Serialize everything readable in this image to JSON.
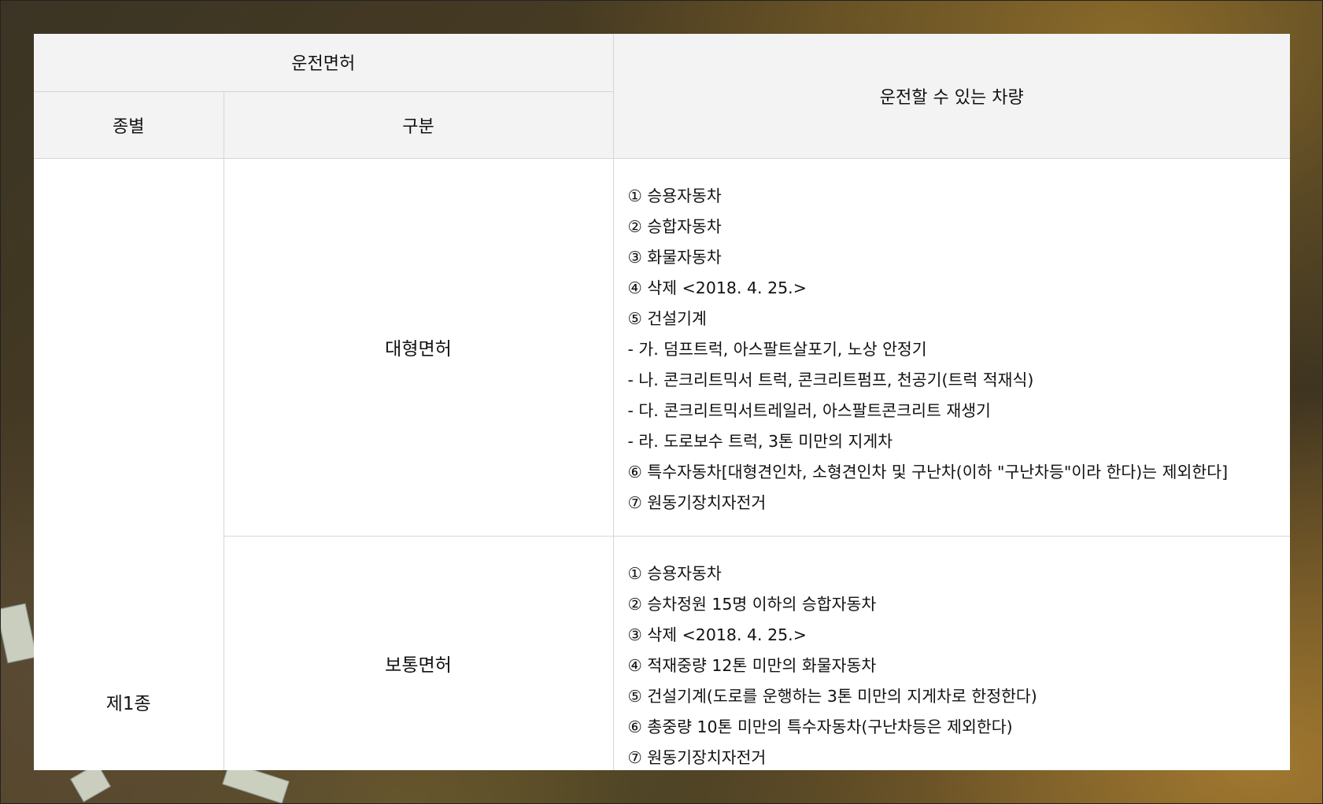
{
  "table": {
    "header": {
      "license_group": "운전면허",
      "vehicles": "운전할 수 있는 차량",
      "type": "종별",
      "category": "구분"
    },
    "type_cell": "제1종",
    "rows": [
      {
        "category": "대형면허",
        "items": [
          "① 승용자동차",
          "② 승합자동차",
          "③ 화물자동차",
          "④ 삭제 <2018. 4. 25.>",
          "⑤ 건설기계",
          "- 가. 덤프트럭, 아스팔트살포기, 노상 안정기",
          "- 나. 콘크리트믹서 트럭, 콘크리트펌프, 천공기(트럭 적재식)",
          "- 다. 콘크리트믹서트레일러, 아스팔트콘크리트 재생기",
          "- 라. 도로보수 트럭, 3톤 미만의 지게차",
          "⑥ 특수자동차[대형견인차, 소형견인차 및 구난차(이하 \"구난차등\"이라 한다)는 제외한다]",
          "⑦ 원동기장치자전거"
        ]
      },
      {
        "category": "보통면허",
        "items": [
          "① 승용자동차",
          "② 승차정원 15명 이하의 승합자동차",
          "③ 삭제 <2018. 4. 25.>",
          "④ 적재중량 12톤 미만의 화물자동차",
          "⑤ 건설기계(도로를 운행하는 3톤 미만의 지게차로 한정한다)",
          "⑥ 총중량 10톤 미만의 특수자동차(구난차등은 제외한다)",
          "⑦ 원동기장치자전거"
        ]
      }
    ]
  }
}
